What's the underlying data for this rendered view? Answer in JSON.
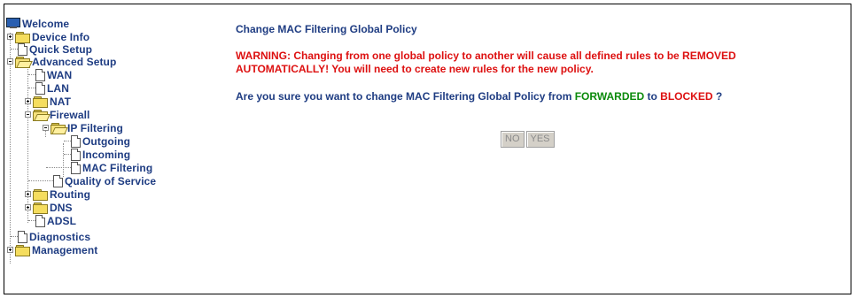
{
  "tree": {
    "welcome": "Welcome",
    "device_info": "Device Info",
    "quick_setup": "Quick Setup",
    "advanced_setup": "Advanced Setup",
    "wan": "WAN",
    "lan": "LAN",
    "nat": "NAT",
    "firewall": "Firewall",
    "ip_filtering": "IP Filtering",
    "outgoing": "Outgoing",
    "incoming": "Incoming",
    "mac_filtering": "MAC Filtering",
    "qos": "Quality of Service",
    "routing": "Routing",
    "dns": "DNS",
    "adsl": "ADSL",
    "diagnostics": "Diagnostics",
    "management": "Management"
  },
  "page": {
    "title": "Change MAC Filtering Global Policy",
    "warning": "WARNING: Changing from one global policy to another will cause all defined rules to be REMOVED AUTOMATICALLY! You will need to create new rules for the new policy.",
    "question_prefix": "Are you sure you want to change MAC Filtering Global Policy from ",
    "from_policy": "FORWARDED",
    "question_mid": " to ",
    "to_policy": "BLOCKED",
    "question_suffix": " ?"
  },
  "buttons": {
    "no": "NO",
    "yes": "YES"
  },
  "colors": {
    "nav_text": "#1e3c82",
    "warning": "#dd1010",
    "forwarded": "#0b8a0b",
    "blocked": "#dd1010"
  }
}
